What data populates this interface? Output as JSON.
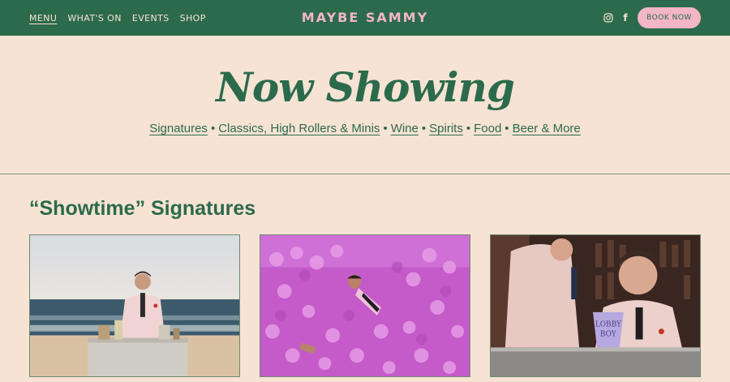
{
  "nav": {
    "items": [
      {
        "label": "MENU",
        "active": true
      },
      {
        "label": "WHAT'S ON",
        "active": false
      },
      {
        "label": "EVENTS",
        "active": false
      },
      {
        "label": "SHOP",
        "active": false
      }
    ],
    "logo": "MAYBE SAMMY",
    "social_icons": [
      "instagram-icon",
      "facebook-icon"
    ],
    "facebook_glyph": "f",
    "book_label": "BOOK NOW"
  },
  "hero": {
    "title": "Now Showing",
    "links": [
      "Signatures",
      "Classics, High Rollers & Minis",
      "Wine",
      "Spirits",
      "Food",
      "Beer & More"
    ],
    "separator": "•"
  },
  "section": {
    "title": "“Showtime” Signatures"
  },
  "cards": [
    {
      "image": "bartender-at-beach-bar-photo"
    },
    {
      "image": "man-in-pink-ball-pit-photo"
    },
    {
      "image": "bartenders-with-lobby-boy-cup-photo",
      "cup_text_1": "LOBBY",
      "cup_text_2": "BOY"
    }
  ],
  "colors": {
    "header_bg": "#2c6a4c",
    "page_bg": "#f7e3d3",
    "accent_pink": "#f2b6c6",
    "text_green": "#2c6a4c"
  }
}
